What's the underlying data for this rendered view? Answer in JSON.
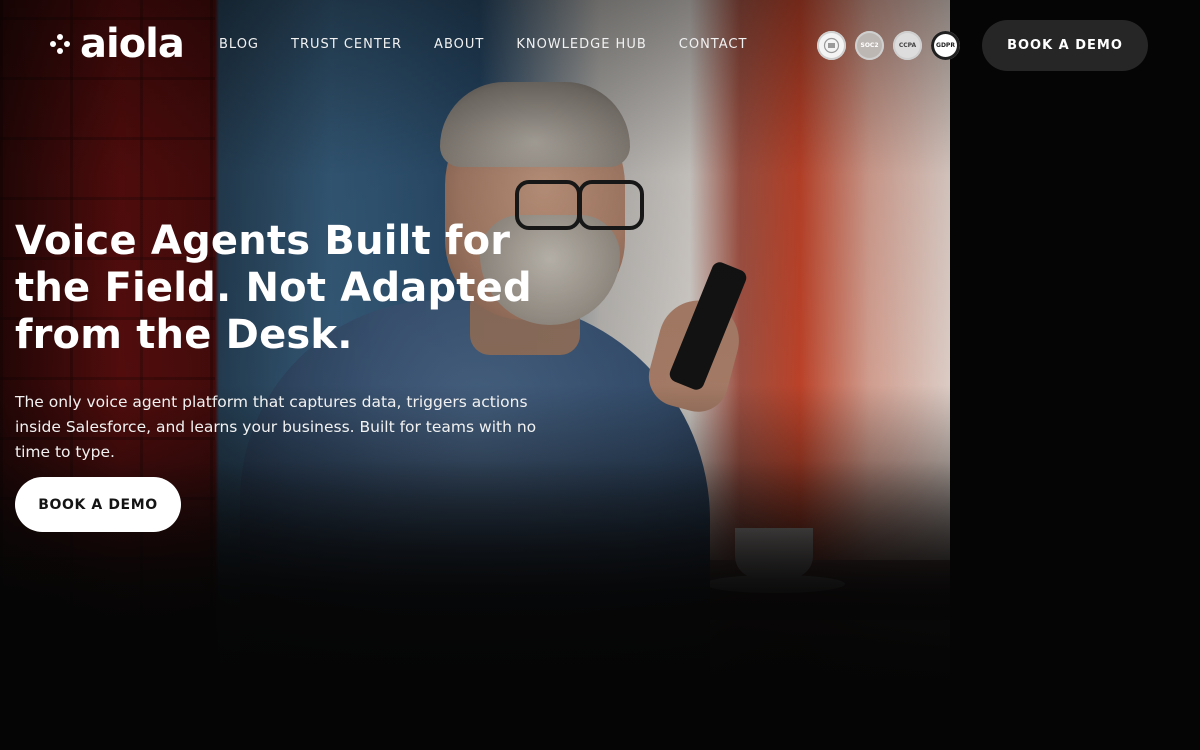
{
  "brand": {
    "name": "aiola"
  },
  "nav": {
    "items": [
      {
        "label": "BLOG"
      },
      {
        "label": "TRUST CENTER"
      },
      {
        "label": "ABOUT"
      },
      {
        "label": "KNOWLEDGE HUB"
      },
      {
        "label": "CONTACT"
      }
    ],
    "cta_label": "BOOK A DEMO"
  },
  "badges": [
    {
      "icon": "iso-certification-badge",
      "label": ""
    },
    {
      "icon": "soc2-badge",
      "label": "SOC2"
    },
    {
      "icon": "ccpa-badge",
      "label": "CCPA"
    },
    {
      "icon": "gdpr-badge",
      "label": "GDPR"
    }
  ],
  "hero": {
    "headline": "Voice Agents Built for the Field. Not Adapted from the Desk.",
    "subheadline": "The only voice agent platform that captures data, triggers actions inside Salesforce, and learns your business. Built for teams with no time to type.",
    "cta_label": "BOOK A DEMO",
    "image": "man-with-glasses-holding-phone-photo"
  },
  "colors": {
    "background": "#050505",
    "nav_cta_bg": "#262626",
    "hero_cta_bg": "#ffffff",
    "text": "#ffffff"
  }
}
